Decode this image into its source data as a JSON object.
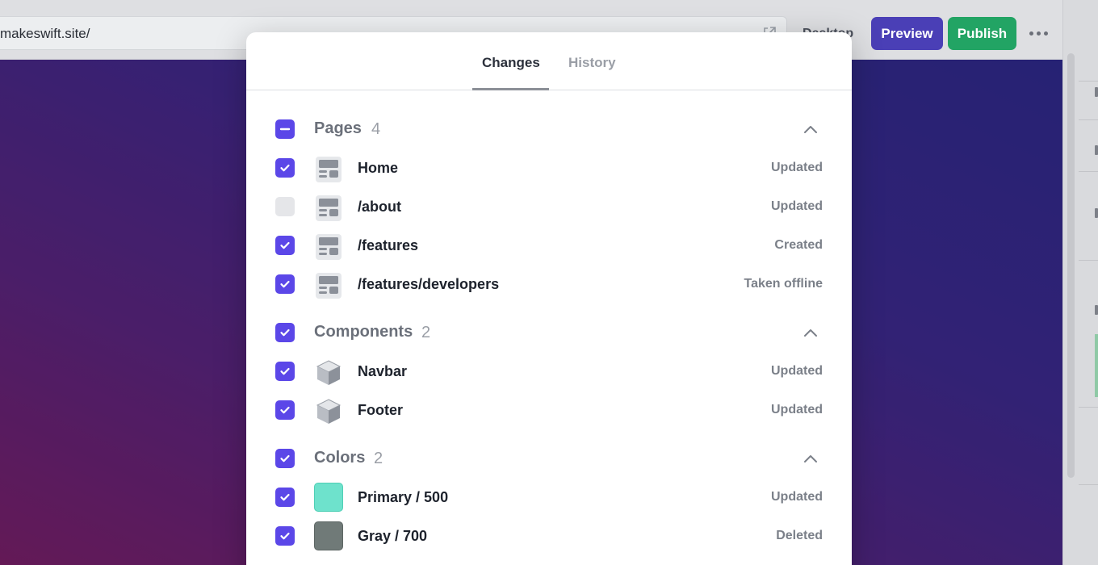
{
  "toolbar": {
    "url": "makeswift.site/",
    "device_label": "Desktop",
    "preview_label": "Preview",
    "publish_label": "Publish",
    "more_icon": "more-dots-icon"
  },
  "modal": {
    "tabs": [
      {
        "label": "Changes",
        "active": true
      },
      {
        "label": "History",
        "active": false
      }
    ],
    "sections": {
      "pages": {
        "title": "Pages",
        "count": "4",
        "state": "indeterminate",
        "items": [
          {
            "label": "Home",
            "status": "Updated",
            "checked": true,
            "icon": "page-layout-icon"
          },
          {
            "label": "/about",
            "status": "Updated",
            "checked": false,
            "icon": "page-layout-icon"
          },
          {
            "label": "/features",
            "status": "Created",
            "checked": true,
            "icon": "page-layout-icon"
          },
          {
            "label": "/features/developers",
            "status": "Taken offline",
            "checked": true,
            "icon": "page-layout-icon"
          }
        ]
      },
      "components": {
        "title": "Components",
        "count": "2",
        "state": "checked",
        "items": [
          {
            "label": "Navbar",
            "status": "Updated",
            "checked": true,
            "icon": "component-cube-icon"
          },
          {
            "label": "Footer",
            "status": "Updated",
            "checked": true,
            "icon": "component-cube-icon"
          }
        ]
      },
      "colors": {
        "title": "Colors",
        "count": "2",
        "state": "checked",
        "items": [
          {
            "label": "Primary / 500",
            "status": "Updated",
            "checked": true,
            "swatch": "#6ee2cc"
          },
          {
            "label": "Gray / 700",
            "status": "Deleted",
            "checked": true,
            "swatch": "#707a78"
          }
        ]
      }
    }
  },
  "colors": {
    "accent": "#5b47e8",
    "preview": "#4a3fb6",
    "publish": "#22a464"
  }
}
